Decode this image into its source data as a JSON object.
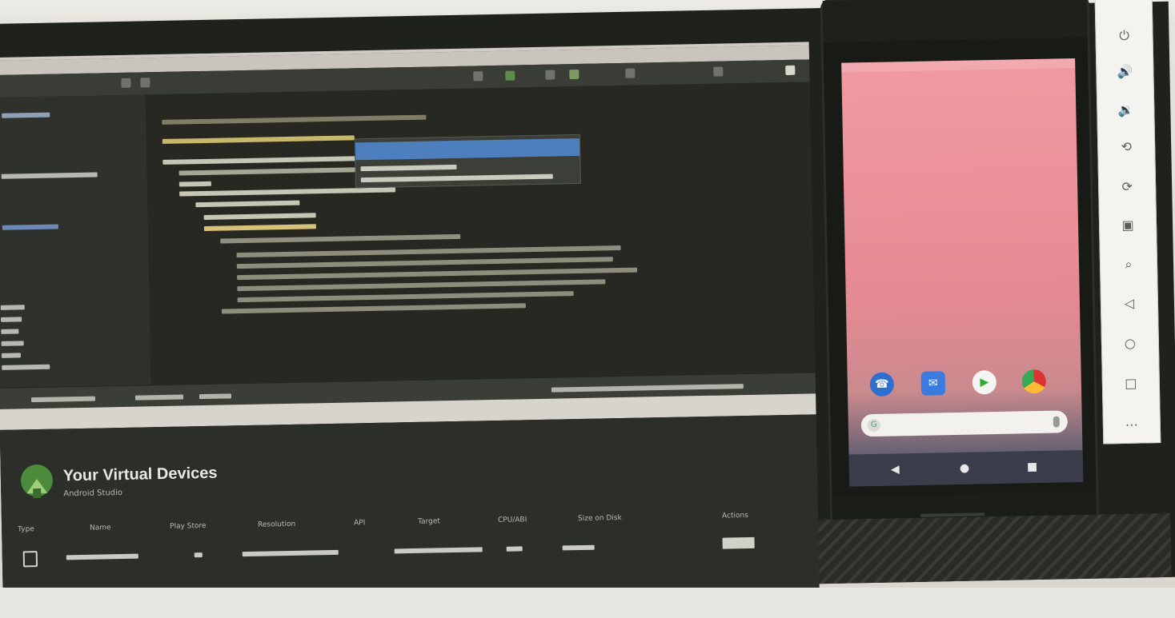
{
  "ide": {
    "window_title": "",
    "status_items": [
      "",
      "",
      "",
      ""
    ]
  },
  "avd_manager": {
    "title": "Your Virtual Devices",
    "subtitle": "Android Studio",
    "columns": [
      "Type",
      "Name",
      "Play Store",
      "Resolution",
      "API",
      "Target",
      "CPU/ABI",
      "Size on Disk",
      "Actions"
    ],
    "devices": [
      {
        "type_icon": "phone-icon",
        "name": "",
        "play_store": "",
        "resolution": "",
        "api": "",
        "target": "",
        "cpu": "",
        "size": ""
      }
    ]
  },
  "emulator": {
    "title": "",
    "apps": [
      "phone-icon",
      "messages-icon",
      "play-store-icon",
      "chrome-icon"
    ],
    "nav": [
      "back-icon",
      "home-icon",
      "recents-icon"
    ],
    "side_toolbar": [
      "power-icon",
      "volume-up-icon",
      "volume-down-icon",
      "rotate-left-icon",
      "rotate-right-icon",
      "camera-icon",
      "zoom-icon",
      "back-icon",
      "home-icon",
      "overview-icon",
      "more-icon"
    ]
  },
  "colors": {
    "ide_bg": "#272822",
    "wallpaper_top": "#f09aa2",
    "selection_blue": "#4d7fbf",
    "avd_bg": "#2c2e29"
  }
}
